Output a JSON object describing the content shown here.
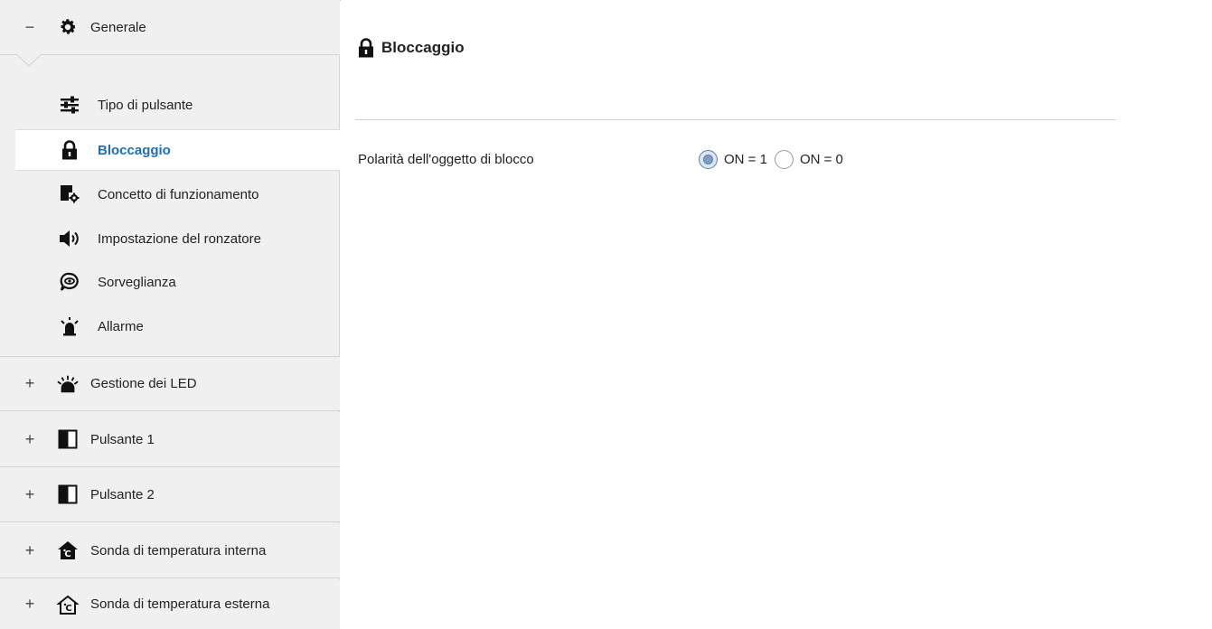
{
  "sidebar": {
    "generale": {
      "toggle": "−",
      "label": "Generale",
      "icon": "gear-icon"
    },
    "subitems": [
      {
        "label": "Tipo di pulsante",
        "icon": "sliders-icon"
      },
      {
        "label": "Bloccaggio",
        "icon": "lock-icon",
        "active": true
      },
      {
        "label": "Concetto di funzionamento",
        "icon": "device-gear-icon"
      },
      {
        "label": "Impostazione del ronzatore",
        "icon": "speaker-icon"
      },
      {
        "label": "Sorveglianza",
        "icon": "eye-bubble-icon"
      },
      {
        "label": "Allarme",
        "icon": "alarm-icon"
      }
    ],
    "groups": [
      {
        "toggle": "+",
        "label": "Gestione dei LED",
        "icon": "led-icon"
      },
      {
        "toggle": "+",
        "label": "Pulsante 1",
        "icon": "button-panel-icon"
      },
      {
        "toggle": "+",
        "label": "Pulsante 2",
        "icon": "button-panel-icon"
      },
      {
        "toggle": "+",
        "label": "Sonda di temperatura interna",
        "icon": "indoor-temp-icon"
      },
      {
        "toggle": "+",
        "label": "Sonda di temperatura esterna",
        "icon": "outdoor-temp-icon"
      }
    ]
  },
  "main": {
    "title": "Bloccaggio",
    "parameter": {
      "label": "Polarità dell'oggetto di blocco",
      "options": [
        {
          "label": "ON = 1",
          "checked": true
        },
        {
          "label": "ON = 0",
          "checked": false
        }
      ]
    }
  },
  "colors": {
    "accent": "#1e6fb8",
    "sidebar_bg": "#f0f0f0"
  }
}
